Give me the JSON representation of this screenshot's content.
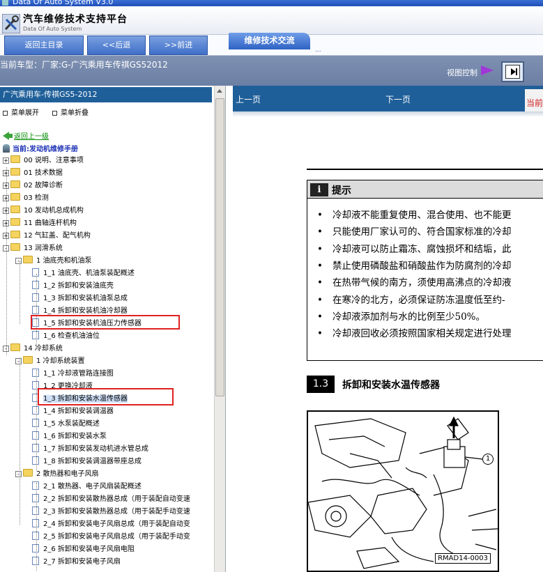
{
  "window": {
    "title": "Data Of Auto System V3.0"
  },
  "header": {
    "title": "汽车维修技术支持平台",
    "subtitle": "Data Of Auto System"
  },
  "nav": {
    "home": "返回主目录",
    "back": "<<后退",
    "forward": ">>前进",
    "active_tab": "维修技术交流",
    "more": "..."
  },
  "info": {
    "current_model": "当前车型：厂家:G-广汽乘用车传祺GS52012",
    "view_control": "视图控制"
  },
  "left": {
    "header": "广汽乘用车-传祺GS5-2012",
    "expand_label": "菜单展开",
    "collapse_label": "菜单折叠",
    "go_up": "返回上一级",
    "current": "当前:发动机维修手册",
    "tree": [
      {
        "label": "00 说明、注意事项",
        "level": 0,
        "type": "folder",
        "toggle": "+"
      },
      {
        "label": "01 技术数据",
        "level": 0,
        "type": "folder",
        "toggle": "+"
      },
      {
        "label": "02 故障诊断",
        "level": 0,
        "type": "folder",
        "toggle": "+"
      },
      {
        "label": "03 检测",
        "level": 0,
        "type": "folder",
        "toggle": "+"
      },
      {
        "label": "10 发动机总成机构",
        "level": 0,
        "type": "folder",
        "toggle": "+"
      },
      {
        "label": "11 曲轴连杆机构",
        "level": 0,
        "type": "folder",
        "toggle": "+"
      },
      {
        "label": "12 气缸盖、配气机构",
        "level": 0,
        "type": "folder",
        "toggle": "+"
      },
      {
        "label": "13 润滑系统",
        "level": 0,
        "type": "folder",
        "toggle": "-"
      },
      {
        "label": "1 油底壳和机油泵",
        "level": 1,
        "type": "folder",
        "toggle": "-"
      },
      {
        "label": "1_1 油底壳、机油泵装配概述",
        "level": 2,
        "type": "page"
      },
      {
        "label": "1_2 拆卸和安装油底壳",
        "level": 2,
        "type": "page"
      },
      {
        "label": "1_3 拆卸和安装机油泵总成",
        "level": 2,
        "type": "page"
      },
      {
        "label": "1_4 拆卸和安装机油冷却器",
        "level": 2,
        "type": "page"
      },
      {
        "label": "1_5 拆卸和安装机油压力传感器",
        "level": 2,
        "type": "page"
      },
      {
        "label": "1_6 检查机油油位",
        "level": 2,
        "type": "page"
      },
      {
        "label": "14 冷却系统",
        "level": 0,
        "type": "folder",
        "toggle": "-"
      },
      {
        "label": "1 冷却系统装置",
        "level": 1,
        "type": "folder",
        "toggle": "-"
      },
      {
        "label": "1_1 冷却液管路连接图",
        "level": 2,
        "type": "page"
      },
      {
        "label": "1_2 更换冷却液",
        "level": 2,
        "type": "page"
      },
      {
        "label": "1_3 拆卸和安装水温传感器",
        "level": 2,
        "type": "page",
        "selected": true
      },
      {
        "label": "1_4 拆卸和安装调温器",
        "level": 2,
        "type": "page"
      },
      {
        "label": "1_5 水泵装配概述",
        "level": 2,
        "type": "page"
      },
      {
        "label": "1_6 拆卸和安装水泵",
        "level": 2,
        "type": "page"
      },
      {
        "label": "1_7 拆卸和安装发动机进水管总成",
        "level": 2,
        "type": "page"
      },
      {
        "label": "1_8 拆卸和安装调温器带座总成",
        "level": 2,
        "type": "page"
      },
      {
        "label": "2 散热器和电子风扇",
        "level": 1,
        "type": "folder",
        "toggle": "-"
      },
      {
        "label": "2_1 散热器、电子风扇装配概述",
        "level": 2,
        "type": "page"
      },
      {
        "label": "2_2 拆卸和安装散热器总成（用于装配自动变速",
        "level": 2,
        "type": "page"
      },
      {
        "label": "2_3 拆卸和安装散热器总成（用于装配手动变速",
        "level": 2,
        "type": "page"
      },
      {
        "label": "2_4 拆卸和安装电子风扇总成（用于装配自动变",
        "level": 2,
        "type": "page"
      },
      {
        "label": "2_5 拆卸和安装电子风扇总成（用于装配手动变",
        "level": 2,
        "type": "page"
      },
      {
        "label": "2_6 拆卸和安装电子风扇电阻",
        "level": 2,
        "type": "page"
      },
      {
        "label": "2_7 拆卸和安装电子风扇",
        "level": 2,
        "type": "page"
      }
    ]
  },
  "content": {
    "prev": "上一页",
    "next": "下一页",
    "current_tag": "当前",
    "note_title": "提示",
    "note_icon": "i",
    "notes": [
      "冷却液不能重复使用、混合使用、也不能更",
      "只能使用厂家认可的、符合国家标准的冷却",
      "冷却液可以防止霜冻、腐蚀损坏和结垢，此",
      "禁止使用磷酸盐和硝酸盐作为防腐剂的冷却",
      "在热带气候的南方，须使用高沸点的冷却液",
      "在寒冷的北方，必须保证防冻温度低至约-",
      "冷却液添加剂与水的比例至少50%。",
      "冷却液回收必须按照国家相关规定进行处理"
    ],
    "section_number": "1.3",
    "section_title": "拆卸和安装水温传感器",
    "diagram_code": "RMAD14-0003",
    "callout": "1"
  }
}
